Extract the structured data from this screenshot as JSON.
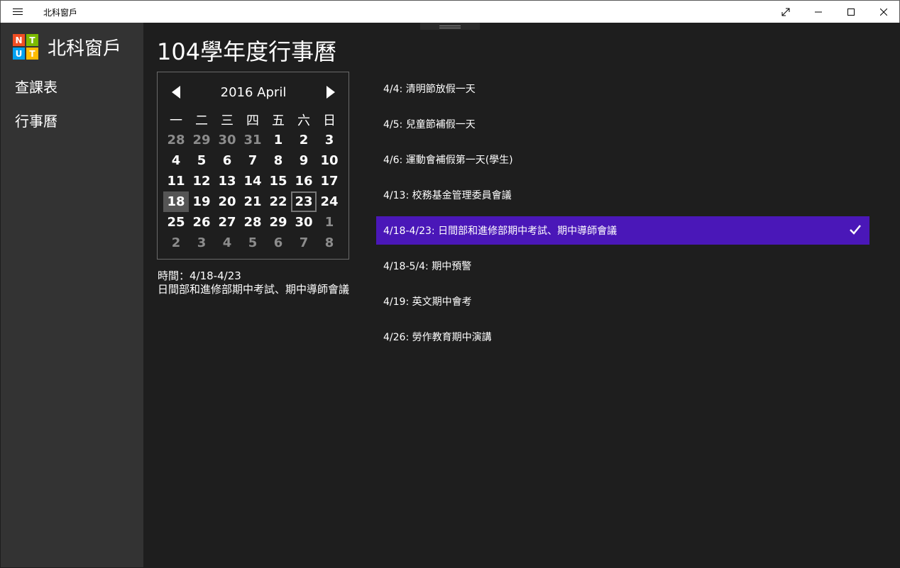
{
  "window": {
    "title": "北科窗戶"
  },
  "sidebar": {
    "app_name": "北科窗戶",
    "logo": {
      "letters": [
        "N",
        "T",
        "U",
        "T"
      ],
      "colors": [
        "#f04e23",
        "#7cbb00",
        "#00a1f1",
        "#ffbb00"
      ]
    },
    "items": [
      {
        "label": "查課表"
      },
      {
        "label": "行事曆"
      }
    ]
  },
  "main": {
    "title": "104學年度行事曆"
  },
  "calendar": {
    "month_label": "2016 April",
    "weekdays": [
      "一",
      "二",
      "三",
      "四",
      "五",
      "六",
      "日"
    ],
    "weeks": [
      [
        "28",
        "29",
        "30",
        "31",
        "1",
        "2",
        "3"
      ],
      [
        "4",
        "5",
        "6",
        "7",
        "8",
        "9",
        "10"
      ],
      [
        "11",
        "12",
        "13",
        "14",
        "15",
        "16",
        "17"
      ],
      [
        "18",
        "19",
        "20",
        "21",
        "22",
        "23",
        "24"
      ],
      [
        "25",
        "26",
        "27",
        "28",
        "29",
        "30",
        "1"
      ],
      [
        "2",
        "3",
        "4",
        "5",
        "6",
        "7",
        "8"
      ]
    ],
    "other_month": [
      [
        true,
        true,
        true,
        true,
        false,
        false,
        false
      ],
      [
        false,
        false,
        false,
        false,
        false,
        false,
        false
      ],
      [
        false,
        false,
        false,
        false,
        false,
        false,
        false
      ],
      [
        false,
        false,
        false,
        false,
        false,
        false,
        false
      ],
      [
        false,
        false,
        false,
        false,
        false,
        false,
        true
      ],
      [
        true,
        true,
        true,
        true,
        true,
        true,
        true
      ]
    ],
    "selected_day": "18",
    "today_day": "23"
  },
  "detail": {
    "time_line": "時間：4/18-4/23",
    "description": "日間部和進修部期中考試、期中導師會議"
  },
  "events": [
    {
      "text": "4/4: 清明節放假一天",
      "active": false
    },
    {
      "text": "4/5: 兒童節補假一天",
      "active": false
    },
    {
      "text": "4/6: 運動會補假第一天(學生)",
      "active": false
    },
    {
      "text": "4/13: 校務基金管理委員會議",
      "active": false
    },
    {
      "text": "4/18-4/23: 日間部和進修部期中考試、期中導師會議",
      "active": true
    },
    {
      "text": "4/18-5/4: 期中預警",
      "active": false
    },
    {
      "text": "4/19: 英文期中會考",
      "active": false
    },
    {
      "text": "4/26: 勞作教育期中演講",
      "active": false
    }
  ],
  "colors": {
    "accent": "#4a17b8",
    "sidebar_bg": "#333333",
    "content_bg": "#1e1e1e"
  }
}
